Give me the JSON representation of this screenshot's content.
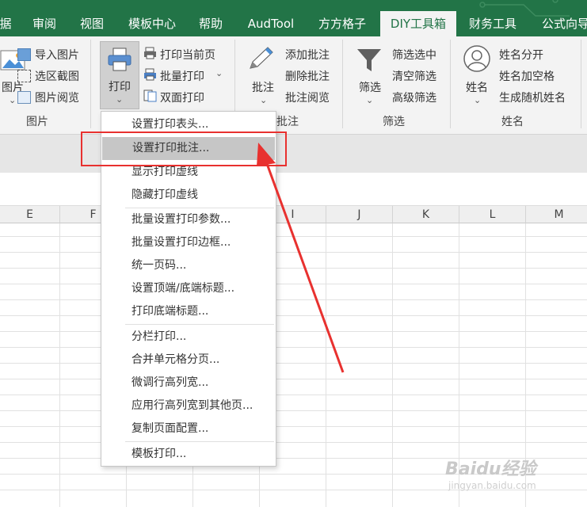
{
  "tabs": [
    "据",
    "审阅",
    "视图",
    "模板中心",
    "帮助",
    "AudTool",
    "方方格子",
    "DIY工具箱",
    "财务工具",
    "公式向导"
  ],
  "ribbon": {
    "picture_group": {
      "big_label": "图片",
      "import": "导入图片",
      "select_capture": "选区截图",
      "browse": "图片阅览",
      "group_label": "图片"
    },
    "print_group": {
      "big_label": "打印",
      "print_current": "打印当前页",
      "batch_print": "批量打印",
      "duplex_print": "双面打印"
    },
    "comment_group": {
      "big_label": "批注",
      "add": "添加批注",
      "delete": "删除批注",
      "browse": "批注阅览",
      "group_label": "批注"
    },
    "filter_group": {
      "big_label": "筛选",
      "filter_selected": "筛选选中",
      "clear_filter": "清空筛选",
      "advanced_filter": "高级筛选",
      "group_label": "筛选"
    },
    "name_group": {
      "big_label": "姓名",
      "split": "姓名分开",
      "add_space": "姓名加空格",
      "random": "生成随机姓名",
      "group_label": "姓名"
    }
  },
  "columns": [
    "E",
    "F",
    "I",
    "J",
    "K",
    "L",
    "M"
  ],
  "menu": {
    "items": [
      "设置打印表头...",
      "设置打印批注...",
      "显示打印虚线",
      "隐藏打印虚线",
      "批量设置打印参数...",
      "批量设置打印边框...",
      "统一页码...",
      "设置顶端/底端标题...",
      "打印底端标题...",
      "分栏打印...",
      "合并单元格分页...",
      "微调行高列宽...",
      "应用行高列宽到其他页...",
      "复制页面配置...",
      "模板打印..."
    ],
    "highlighted_index": 1
  },
  "watermark": {
    "main": "Baidu经验",
    "sub": "jingyan.baidu.com"
  },
  "colors": {
    "accent": "#227447",
    "highlight": "#c6c6c6",
    "annotation": "#e8312f"
  }
}
